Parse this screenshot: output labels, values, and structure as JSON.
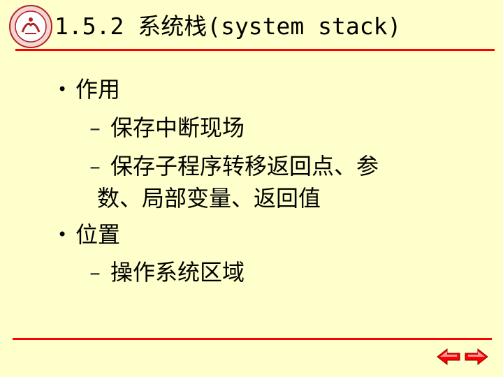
{
  "slide": {
    "title": "1.5.2 系统栈(system stack)"
  },
  "bullets": [
    {
      "label": "作用",
      "items": [
        "保存中断现场",
        "保存子程序转移返回点、参",
        "数、局部变量、返回值"
      ]
    },
    {
      "label": "位置",
      "items": [
        "操作系统区域"
      ]
    }
  ],
  "colors": {
    "background": "#ffffcc",
    "rule": "#ff0000",
    "nav_arrow": "#ff0000"
  },
  "icons": {
    "logo": "university-seal-logo",
    "prev": "prev-arrow-icon",
    "next": "next-arrow-icon"
  }
}
